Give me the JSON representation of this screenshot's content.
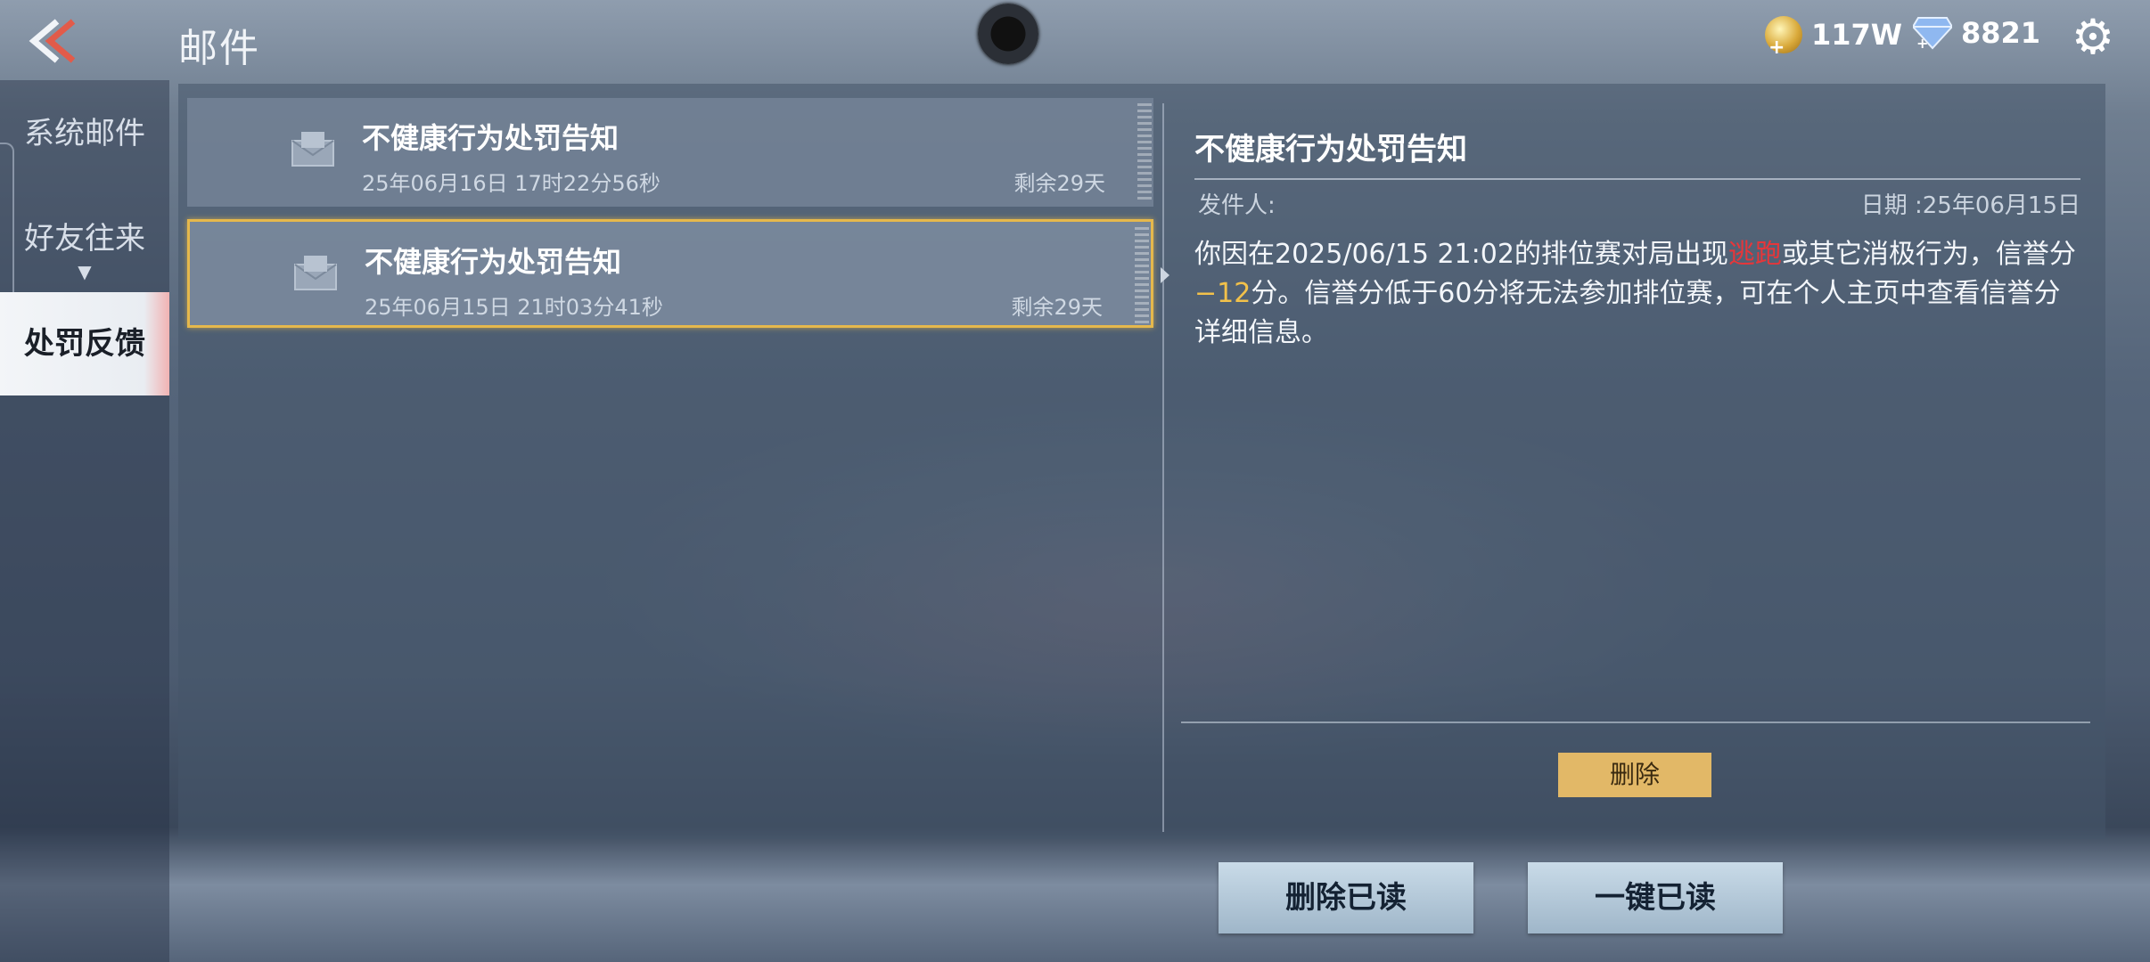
{
  "header": {
    "title": "邮件",
    "gold_amount": "117W",
    "gem_amount": "8821",
    "icons": {
      "back": "back-chevron-icon",
      "gold": "gold-coin-icon",
      "gem": "diamond-icon",
      "settings": "gear-icon"
    }
  },
  "sidebar": {
    "items": [
      {
        "label": "系统邮件"
      },
      {
        "label": "好友往来"
      },
      {
        "label": "处罚反馈"
      }
    ],
    "active": "处罚反馈"
  },
  "mails": [
    {
      "subject": "不健康行为处罚告知",
      "time": "25年06月16日 17时22分56秒",
      "remaining": "剩余29天"
    },
    {
      "subject": "不健康行为处罚告知",
      "time": "25年06月15日 21时03分41秒",
      "remaining": "剩余29天"
    }
  ],
  "detail": {
    "title": "不健康行为处罚告知",
    "sender_label": "发件人:",
    "date_label": "日期 :25年06月15日",
    "body_part1": "你因在2025/06/15 21:02的排位赛对局出现",
    "body_highlight": "逃跑",
    "body_part2": "或其它消极行为，信誉分",
    "body_penalty": "−12",
    "body_part3": "分。信誉分低于60分将无法参加排位赛，可在个人主页中查看信誉分详细信息。",
    "delete_label": "删除"
  },
  "footer": {
    "delete_read_label": "删除已读",
    "read_all_label": "一键已读"
  },
  "colors": {
    "accent_gold": "#e5b84c",
    "penalty_yellow": "#f2c14a",
    "highlight_red": "#e6363a"
  }
}
